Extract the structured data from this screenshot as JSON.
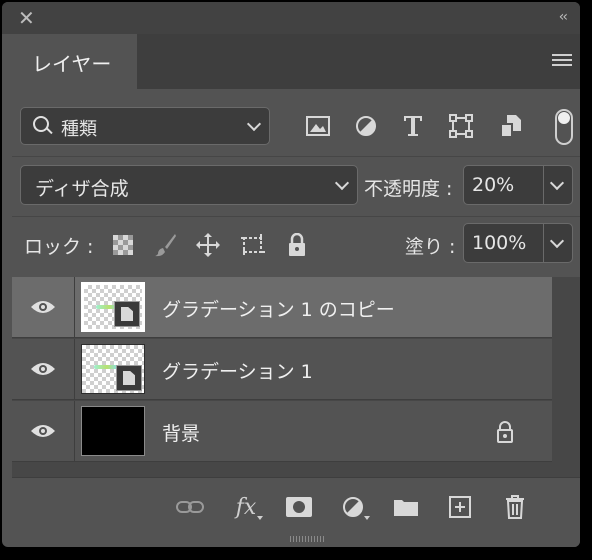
{
  "panel": {
    "tab_label": "レイヤー"
  },
  "filter": {
    "label": "種類"
  },
  "blend": {
    "mode": "ディザ合成",
    "opacity_label": "不透明度 :",
    "opacity_value": "20%"
  },
  "lock": {
    "label": "ロック :",
    "fill_label": "塗り :",
    "fill_value": "100%"
  },
  "layers": [
    {
      "name": "グラデーション 1 のコピー",
      "selected": true,
      "visible": true
    },
    {
      "name": "グラデーション 1",
      "selected": false,
      "visible": true
    },
    {
      "name": "背景",
      "selected": false,
      "visible": true,
      "locked": true
    }
  ],
  "icons": {
    "titlebar": [
      "close-icon",
      "collapse-icon"
    ],
    "filter": [
      "image-filter-icon",
      "adjustment-filter-icon",
      "type-filter-icon",
      "shape-filter-icon",
      "smart-object-filter-icon"
    ],
    "lock": [
      "lock-transparent-icon",
      "lock-image-icon",
      "lock-position-icon",
      "lock-artboard-icon",
      "lock-all-icon"
    ],
    "footer": [
      "link-icon",
      "fx-icon",
      "mask-icon",
      "adjustment-layer-icon",
      "group-icon",
      "new-layer-icon",
      "trash-icon"
    ]
  },
  "colors": {
    "panel_bg": "#535353",
    "selected_row": "#6c6c6c",
    "field_bg": "#3c3c3c"
  }
}
